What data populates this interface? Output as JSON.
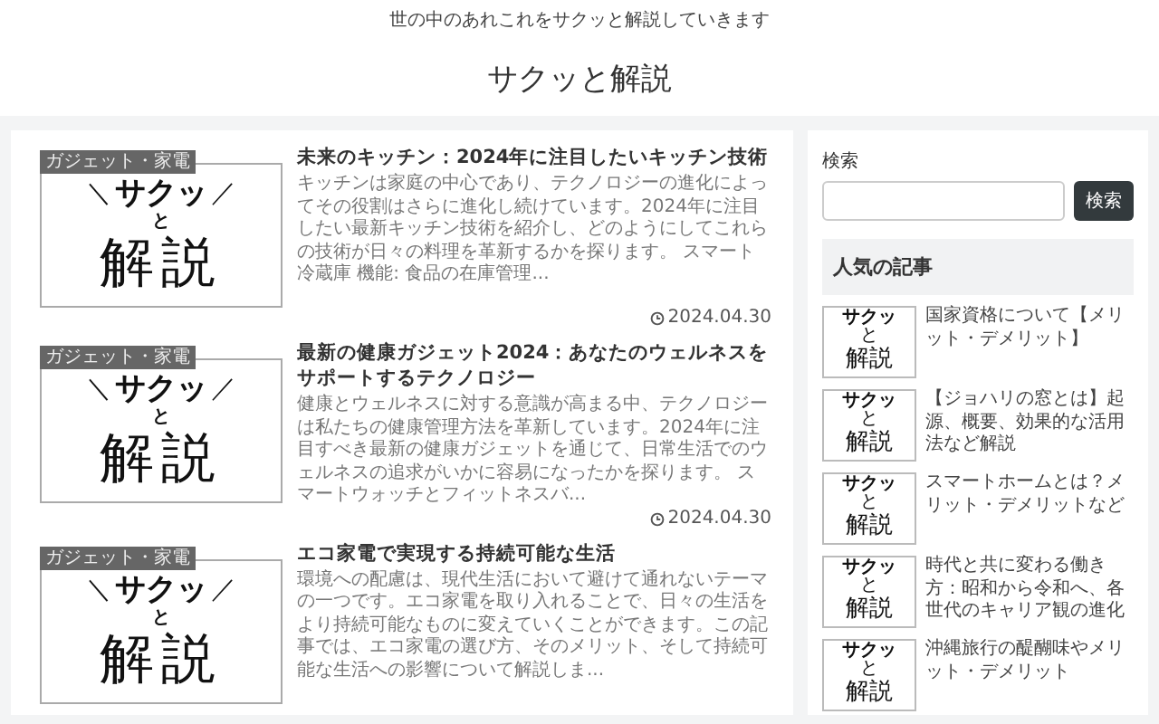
{
  "header": {
    "tagline": "世の中のあれこれをサクッと解説していきます",
    "site_title": "サクッと解説"
  },
  "articles": [
    {
      "thumbnail": {
        "category": "ガジェット・家電",
        "left_mark": "＼",
        "top": "サクッ",
        "right_mark": "／",
        "middle": "と",
        "bottom": "解説"
      },
      "title": "未来のキッチン：2024年に注目したいキッチン技術",
      "snippet": "キッチンは家庭の中心であり、テクノロジーの進化によってその役割はさらに進化し続けています。2024年に注目したい最新キッチン技術を紹介し、どのようにしてこれらの技術が日々の料理を革新するかを探ります。 スマート冷蔵庫 機能: 食品の在庫管理...",
      "date": "2024.04.30"
    },
    {
      "thumbnail": {
        "category": "ガジェット・家電",
        "left_mark": "＼",
        "top": "サクッ",
        "right_mark": "／",
        "middle": "と",
        "bottom": "解説"
      },
      "title": "最新の健康ガジェット2024：あなたのウェルネスをサポートするテクノロジー",
      "snippet": "健康とウェルネスに対する意識が高まる中、テクノロジーは私たちの健康管理方法を革新しています。2024年に注目すべき最新の健康ガジェットを通じて、日常生活でのウェルネスの追求がいかに容易になったかを探ります。 スマートウォッチとフィットネスバ...",
      "date": "2024.04.30"
    },
    {
      "thumbnail": {
        "category": "ガジェット・家電",
        "left_mark": "＼",
        "top": "サクッ",
        "right_mark": "／",
        "middle": "と",
        "bottom": "解説"
      },
      "title": "エコ家電で実現する持続可能な生活",
      "snippet": "環境への配慮は、現代生活において避けて通れないテーマの一つです。エコ家電を取り入れることで、日々の生活をより持続可能なものに変えていくことができます。この記事では、エコ家電の選び方、そのメリット、そして持続可能な生活への影響について解説しま..."
    }
  ],
  "sidebar": {
    "search": {
      "label": "検索",
      "button": "検索"
    },
    "popular": {
      "heading": "人気の記事",
      "items": [
        {
          "thumbnail": {
            "top": "サクッ",
            "middle": "と",
            "bottom": "解説"
          },
          "title": "国家資格について【メリット・デメリット】"
        },
        {
          "thumbnail": {
            "top": "サクッ",
            "middle": "と",
            "bottom": "解説"
          },
          "title": "【ジョハリの窓とは】起源、概要、効果的な活用法など解説"
        },
        {
          "thumbnail": {
            "top": "サクッ",
            "middle": "と",
            "bottom": "解説"
          },
          "title": "スマートホームとは？メリット・デメリットなど"
        },
        {
          "thumbnail": {
            "top": "サクッ",
            "middle": "と",
            "bottom": "解説"
          },
          "title": "時代と共に変わる働き方：昭和から令和へ、各世代のキャリア観の進化"
        },
        {
          "thumbnail": {
            "top": "サクッ",
            "middle": "と",
            "bottom": "解説"
          },
          "title": "沖縄旅行の醍醐味やメリット・デメリット"
        }
      ]
    }
  }
}
